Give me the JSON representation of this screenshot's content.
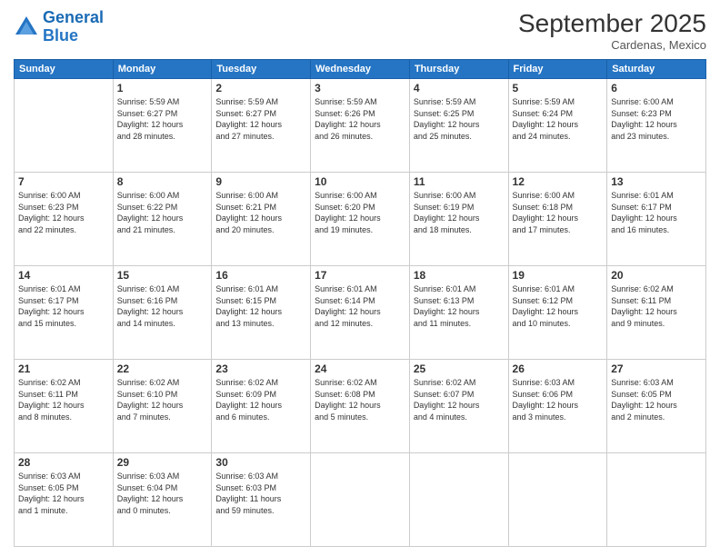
{
  "logo": {
    "line1": "General",
    "line2": "Blue"
  },
  "title": "September 2025",
  "subtitle": "Cardenas, Mexico",
  "days_header": [
    "Sunday",
    "Monday",
    "Tuesday",
    "Wednesday",
    "Thursday",
    "Friday",
    "Saturday"
  ],
  "weeks": [
    [
      {
        "day": "",
        "info": ""
      },
      {
        "day": "1",
        "info": "Sunrise: 5:59 AM\nSunset: 6:27 PM\nDaylight: 12 hours\nand 28 minutes."
      },
      {
        "day": "2",
        "info": "Sunrise: 5:59 AM\nSunset: 6:27 PM\nDaylight: 12 hours\nand 27 minutes."
      },
      {
        "day": "3",
        "info": "Sunrise: 5:59 AM\nSunset: 6:26 PM\nDaylight: 12 hours\nand 26 minutes."
      },
      {
        "day": "4",
        "info": "Sunrise: 5:59 AM\nSunset: 6:25 PM\nDaylight: 12 hours\nand 25 minutes."
      },
      {
        "day": "5",
        "info": "Sunrise: 5:59 AM\nSunset: 6:24 PM\nDaylight: 12 hours\nand 24 minutes."
      },
      {
        "day": "6",
        "info": "Sunrise: 6:00 AM\nSunset: 6:23 PM\nDaylight: 12 hours\nand 23 minutes."
      }
    ],
    [
      {
        "day": "7",
        "info": "Sunrise: 6:00 AM\nSunset: 6:23 PM\nDaylight: 12 hours\nand 22 minutes."
      },
      {
        "day": "8",
        "info": "Sunrise: 6:00 AM\nSunset: 6:22 PM\nDaylight: 12 hours\nand 21 minutes."
      },
      {
        "day": "9",
        "info": "Sunrise: 6:00 AM\nSunset: 6:21 PM\nDaylight: 12 hours\nand 20 minutes."
      },
      {
        "day": "10",
        "info": "Sunrise: 6:00 AM\nSunset: 6:20 PM\nDaylight: 12 hours\nand 19 minutes."
      },
      {
        "day": "11",
        "info": "Sunrise: 6:00 AM\nSunset: 6:19 PM\nDaylight: 12 hours\nand 18 minutes."
      },
      {
        "day": "12",
        "info": "Sunrise: 6:00 AM\nSunset: 6:18 PM\nDaylight: 12 hours\nand 17 minutes."
      },
      {
        "day": "13",
        "info": "Sunrise: 6:01 AM\nSunset: 6:17 PM\nDaylight: 12 hours\nand 16 minutes."
      }
    ],
    [
      {
        "day": "14",
        "info": "Sunrise: 6:01 AM\nSunset: 6:17 PM\nDaylight: 12 hours\nand 15 minutes."
      },
      {
        "day": "15",
        "info": "Sunrise: 6:01 AM\nSunset: 6:16 PM\nDaylight: 12 hours\nand 14 minutes."
      },
      {
        "day": "16",
        "info": "Sunrise: 6:01 AM\nSunset: 6:15 PM\nDaylight: 12 hours\nand 13 minutes."
      },
      {
        "day": "17",
        "info": "Sunrise: 6:01 AM\nSunset: 6:14 PM\nDaylight: 12 hours\nand 12 minutes."
      },
      {
        "day": "18",
        "info": "Sunrise: 6:01 AM\nSunset: 6:13 PM\nDaylight: 12 hours\nand 11 minutes."
      },
      {
        "day": "19",
        "info": "Sunrise: 6:01 AM\nSunset: 6:12 PM\nDaylight: 12 hours\nand 10 minutes."
      },
      {
        "day": "20",
        "info": "Sunrise: 6:02 AM\nSunset: 6:11 PM\nDaylight: 12 hours\nand 9 minutes."
      }
    ],
    [
      {
        "day": "21",
        "info": "Sunrise: 6:02 AM\nSunset: 6:11 PM\nDaylight: 12 hours\nand 8 minutes."
      },
      {
        "day": "22",
        "info": "Sunrise: 6:02 AM\nSunset: 6:10 PM\nDaylight: 12 hours\nand 7 minutes."
      },
      {
        "day": "23",
        "info": "Sunrise: 6:02 AM\nSunset: 6:09 PM\nDaylight: 12 hours\nand 6 minutes."
      },
      {
        "day": "24",
        "info": "Sunrise: 6:02 AM\nSunset: 6:08 PM\nDaylight: 12 hours\nand 5 minutes."
      },
      {
        "day": "25",
        "info": "Sunrise: 6:02 AM\nSunset: 6:07 PM\nDaylight: 12 hours\nand 4 minutes."
      },
      {
        "day": "26",
        "info": "Sunrise: 6:03 AM\nSunset: 6:06 PM\nDaylight: 12 hours\nand 3 minutes."
      },
      {
        "day": "27",
        "info": "Sunrise: 6:03 AM\nSunset: 6:05 PM\nDaylight: 12 hours\nand 2 minutes."
      }
    ],
    [
      {
        "day": "28",
        "info": "Sunrise: 6:03 AM\nSunset: 6:05 PM\nDaylight: 12 hours\nand 1 minute."
      },
      {
        "day": "29",
        "info": "Sunrise: 6:03 AM\nSunset: 6:04 PM\nDaylight: 12 hours\nand 0 minutes."
      },
      {
        "day": "30",
        "info": "Sunrise: 6:03 AM\nSunset: 6:03 PM\nDaylight: 11 hours\nand 59 minutes."
      },
      {
        "day": "",
        "info": ""
      },
      {
        "day": "",
        "info": ""
      },
      {
        "day": "",
        "info": ""
      },
      {
        "day": "",
        "info": ""
      }
    ]
  ]
}
